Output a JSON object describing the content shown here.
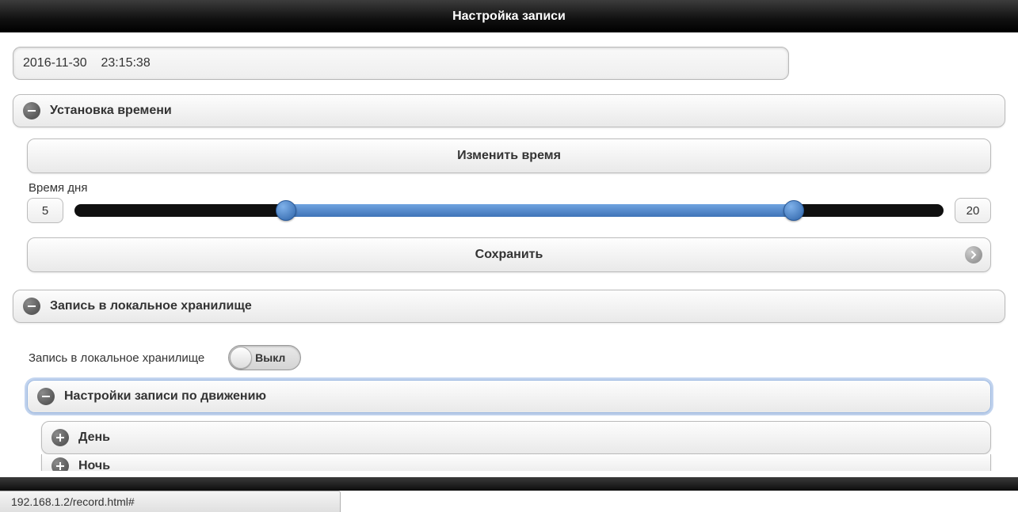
{
  "header": {
    "title": "Настройка записи"
  },
  "datetime": "2016-11-30    23:15:38",
  "time_section": {
    "title": "Установка времени",
    "change_btn": "Изменить время",
    "daytime_label": "Время дня",
    "slider": {
      "min_display": "5",
      "max_display": "20",
      "low_pct": 24.3,
      "high_pct": 82.8
    },
    "save_btn": "Сохранить"
  },
  "local_section": {
    "title": "Запись в локальное хранилище",
    "toggle_label": "Запись в локальное хранилище",
    "toggle_state": "Выкл"
  },
  "motion_section": {
    "title": "Настройки записи по движению",
    "sub": {
      "day": "День",
      "night": "Ночь"
    }
  },
  "status_url": "192.168.1.2/record.html#"
}
